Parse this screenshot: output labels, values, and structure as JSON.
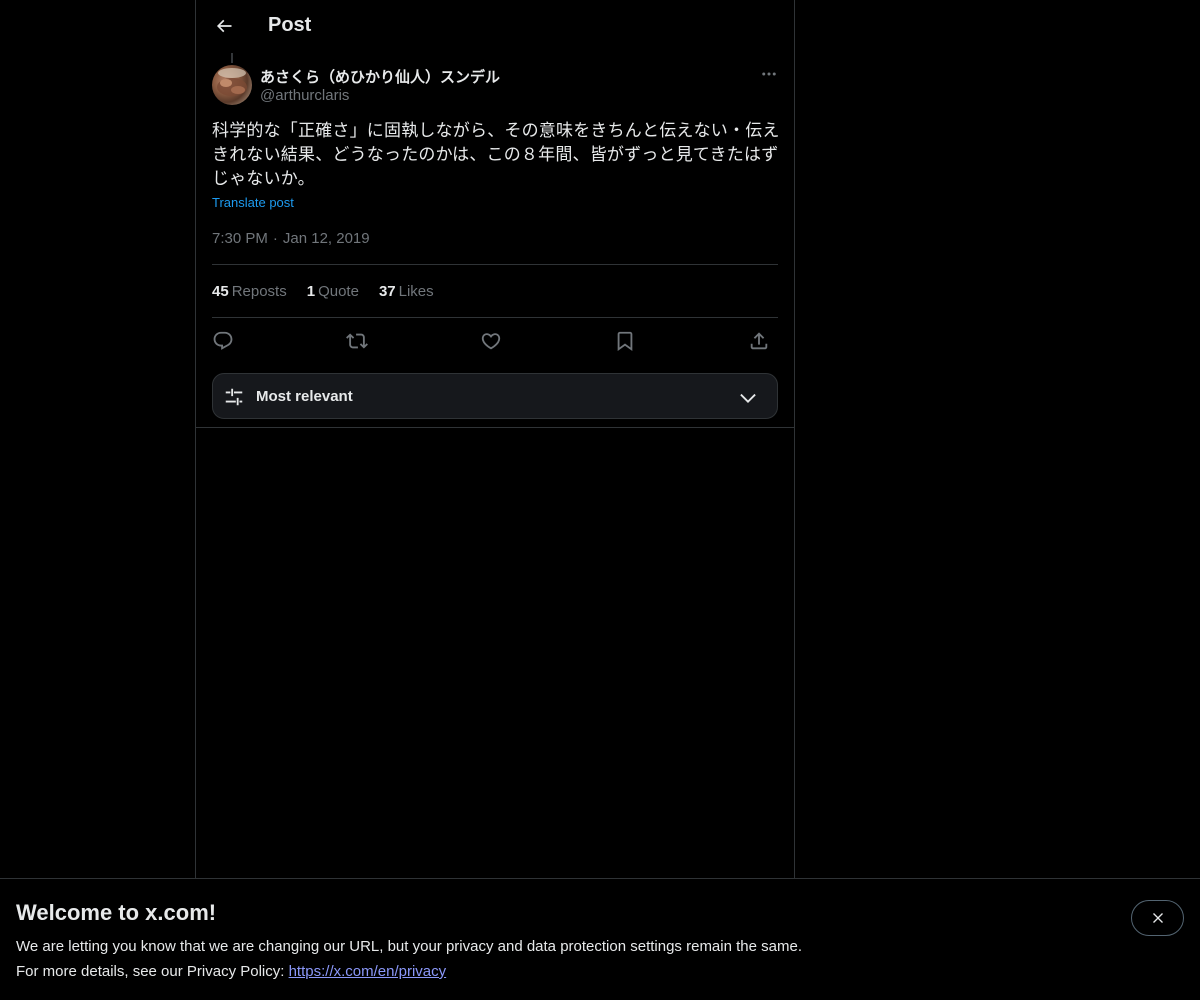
{
  "header": {
    "title": "Post",
    "back_icon": "back-arrow-icon"
  },
  "post": {
    "author": {
      "display_name": "あさくら（めひかり仙人）スンデル",
      "handle": "@arthurclaris"
    },
    "text": "科学的な「正確さ」に固執しながら、その意味をきちんと伝えない・伝えきれない結果、どうなったのかは、この８年間、皆がずっと見てきたはずじゃないか。",
    "translate_label": "Translate post",
    "time": "7:30 PM",
    "separator": "·",
    "date": "Jan 12, 2019",
    "stats": {
      "reposts_count": "45",
      "reposts_label": "Reposts",
      "quotes_count": "1",
      "quotes_label": "Quote",
      "likes_count": "37",
      "likes_label": "Likes"
    },
    "actions": [
      "reply-icon",
      "repost-icon",
      "like-icon",
      "bookmark-icon",
      "share-icon"
    ]
  },
  "sort": {
    "label": "Most relevant",
    "icon": "filter-sliders-icon"
  },
  "banner": {
    "title": "Welcome to x.com!",
    "line1": "We are letting you know that we are changing our URL, but your privacy and data protection settings remain the same.",
    "line2_prefix": "For more details, see our Privacy Policy: ",
    "link_text": "https://x.com/en/privacy",
    "close_icon": "close-icon"
  },
  "colors": {
    "background": "#000000",
    "text_primary": "#e7e9ea",
    "text_secondary": "#71767b",
    "accent": "#1d9bf0",
    "border": "#2f3336",
    "link": "#8b98f9"
  }
}
